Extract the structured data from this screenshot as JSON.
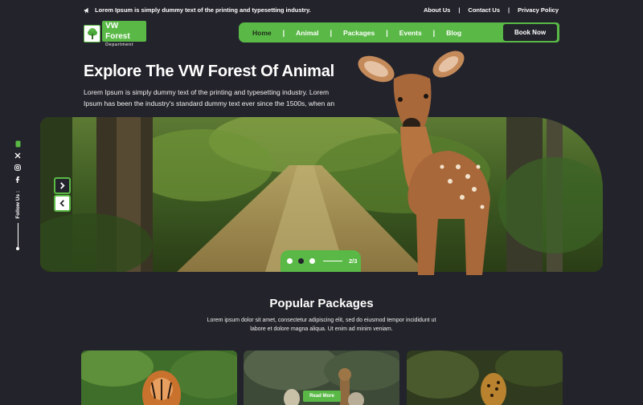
{
  "topbar": {
    "announcement": "Lorem Ipsum is simply dummy text of the printing and typesetting industry.",
    "links": [
      "About Us",
      "Contact Us",
      "Privacy Policy"
    ]
  },
  "logo": {
    "title": "VW Forest",
    "subtitle": "Department"
  },
  "nav": {
    "items": [
      "Home",
      "Animal",
      "Packages",
      "Events",
      "Blog"
    ],
    "active": "Home",
    "cta": "Book Now"
  },
  "hero": {
    "title": "Explore The VW Forest Of Animal",
    "description": "Lorem Ipsum is simply dummy text of the printing and typesetting industry. Lorem Ipsum has been the industry's standard dummy text ever since the 1500s, when an",
    "slide_counter": "2/3",
    "active_dot": 1
  },
  "social": {
    "label": "Follow Us :",
    "icons": [
      "whatsapp-icon",
      "x-icon",
      "instagram-icon",
      "facebook-icon"
    ]
  },
  "packages": {
    "title": "Popular Packages",
    "description": "Lorem ipsum dolor sit amet, consectetur adipiscing elit, sed do eiusmod tempor incididunt ut labore et dolore magna aliqua. Ut enim ad minim veniam.",
    "read_more": "Read More"
  },
  "colors": {
    "accent": "#5ab946",
    "background": "#23232b"
  }
}
